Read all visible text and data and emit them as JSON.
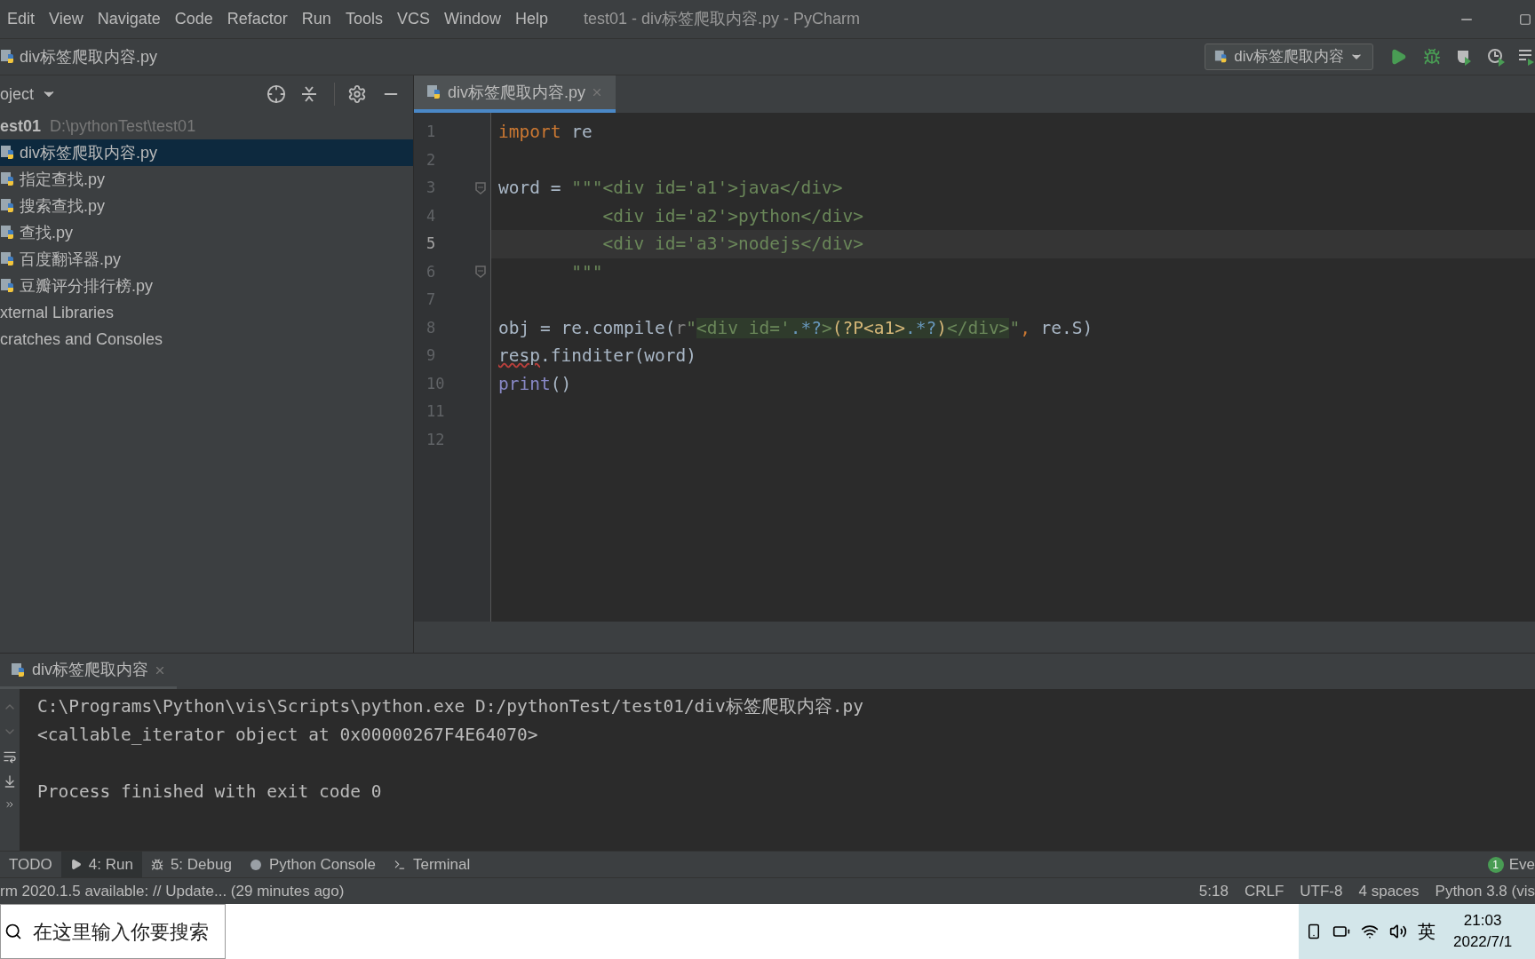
{
  "menu": [
    "Edit",
    "View",
    "Navigate",
    "Code",
    "Refactor",
    "Run",
    "Tools",
    "VCS",
    "Window",
    "Help"
  ],
  "window": {
    "title": "test01 - div标签爬取内容.py - PyCharm"
  },
  "breadcrumb": "div标签爬取内容.py",
  "run_config": "div标签爬取内容",
  "project_panel": {
    "title": "oject",
    "root": {
      "name": "est01",
      "path": "D:\\pythonTest\\test01",
      "children": [
        {
          "name": "div标签爬取内容.py",
          "selected": true
        },
        {
          "name": "指定查找.py",
          "selected": false
        },
        {
          "name": "搜索查找.py",
          "selected": false
        },
        {
          "name": "查找.py",
          "selected": false
        },
        {
          "name": "百度翻译器.py",
          "selected": false
        },
        {
          "name": "豆瓣评分排行榜.py",
          "selected": false
        }
      ]
    },
    "other": [
      "xternal Libraries",
      "cratches and Consoles"
    ]
  },
  "editor_tabs": [
    {
      "label": "div标签爬取内容.py",
      "selected": true
    }
  ],
  "code_lines": [
    {
      "number": "1",
      "current": false,
      "fold": false,
      "tokens": [
        {
          "text": "import",
          "kind": "keyword"
        },
        {
          "text": " re",
          "kind": "plain"
        }
      ]
    },
    {
      "number": "2",
      "current": false,
      "fold": false
    },
    {
      "number": "3",
      "current": false,
      "fold": true,
      "tokens": [
        {
          "text": "word = ",
          "kind": "plain"
        },
        {
          "text": "\"\"\"<div id='a1'>java</div>",
          "kind": "string"
        }
      ]
    },
    {
      "number": "4",
      "current": false,
      "fold": false,
      "tokens": [
        {
          "text": "          <div id='a2'>python</div>",
          "kind": "string"
        }
      ]
    },
    {
      "number": "5",
      "current": true,
      "fold": false,
      "tokens": [
        {
          "text": "          <div id='a3'>nodejs</div>",
          "kind": "string"
        }
      ]
    },
    {
      "number": "6",
      "current": false,
      "fold": true,
      "tokens": [
        {
          "text": "       \"\"\"",
          "kind": "string"
        }
      ]
    },
    {
      "number": "7",
      "current": false,
      "fold": false
    },
    {
      "number": "8",
      "current": false,
      "fold": false,
      "tokens": [
        {
          "text": "obj = re.compile(",
          "kind": "plain"
        },
        {
          "text": "r",
          "kind": "prefix"
        },
        {
          "text": "\"",
          "kind": "string"
        },
        {
          "text": "<div id='",
          "kind": "regex"
        },
        {
          "text": ".*?",
          "kind": "meta"
        },
        {
          "text": ">",
          "kind": "regex"
        },
        {
          "text": "(?P<a1>",
          "kind": "group"
        },
        {
          "text": ".*?",
          "kind": "meta"
        },
        {
          "text": ")",
          "kind": "group"
        },
        {
          "text": "</div>",
          "kind": "regex"
        },
        {
          "text": "\"",
          "kind": "string"
        },
        {
          "text": ", ",
          "kind": "keyword"
        },
        {
          "text": "re.S)",
          "kind": "plain"
        }
      ]
    },
    {
      "number": "9",
      "current": false,
      "fold": false,
      "tokens": [
        {
          "text": "resp",
          "kind": "error"
        },
        {
          "text": ".finditer(word)",
          "kind": "plain"
        }
      ]
    },
    {
      "number": "10",
      "current": false,
      "fold": false,
      "tokens": [
        {
          "text": "print",
          "kind": "builtin"
        },
        {
          "text": "()",
          "kind": "plain"
        }
      ]
    },
    {
      "number": "11",
      "current": false,
      "fold": false
    },
    {
      "number": "12",
      "current": false,
      "fold": false
    }
  ],
  "run_panel": {
    "tab": "div标签爬取内容",
    "output": [
      {
        "text": "C:\\Programs\\Python\\vis\\Scripts\\python.exe D:/pythonTest/test01/div标签爬取内容.py",
        "blank_before": false
      },
      {
        "text": "<callable_iterator object at 0x00000267F4E64070>",
        "blank_before": false
      },
      {
        "text": "Process finished with exit code 0",
        "blank_before": true
      }
    ]
  },
  "tool_tabs": [
    {
      "label": "TODO",
      "selected": false,
      "kind": "plain"
    },
    {
      "label": "4: Run",
      "selected": true,
      "kind": "run"
    },
    {
      "label": "5: Debug",
      "selected": false,
      "kind": "debug"
    },
    {
      "label": "Python Console",
      "selected": false,
      "kind": "python"
    },
    {
      "label": "Terminal",
      "selected": false,
      "kind": "terminal"
    }
  ],
  "event_log": {
    "count": "1",
    "label": "Eve"
  },
  "status_bar": {
    "message": "rm 2020.1.5 available: // Update... (29 minutes ago)",
    "items": [
      "5:18",
      "CRLF",
      "UTF-8",
      "4 spaces",
      "Python 3.8 (vis"
    ]
  },
  "taskbar": {
    "search_placeholder": "在这里输入你要搜索",
    "ime": "英",
    "time": "21:03",
    "date": "2022/7/1"
  }
}
